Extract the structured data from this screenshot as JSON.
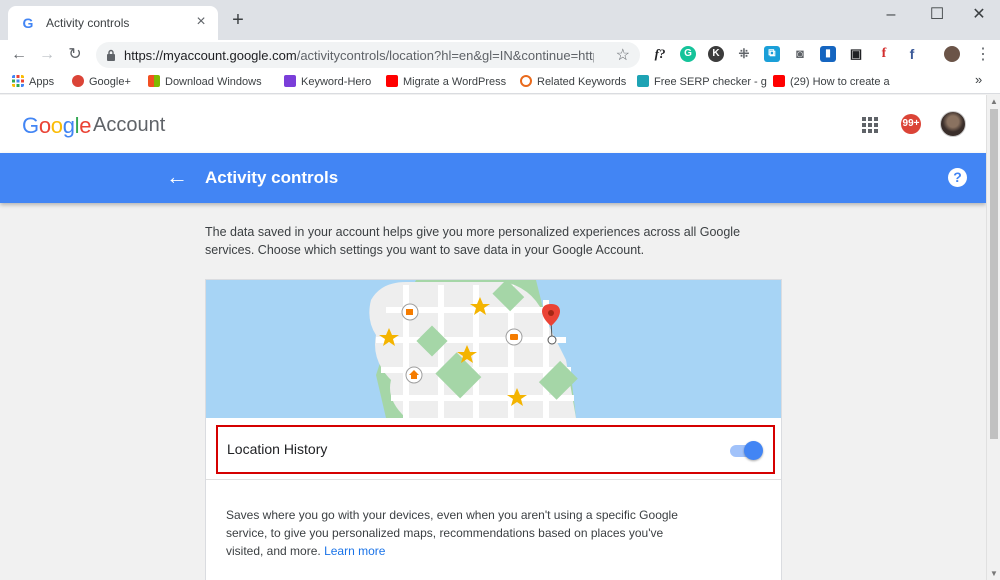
{
  "browser": {
    "tab_title": "Activity controls",
    "url_host": "https://myaccount.google.com",
    "url_path": "/activitycontrols/location?hl=en&gl=IN&continue=http...",
    "window_controls": [
      "–",
      "☐",
      "✕"
    ],
    "bookmarks": [
      {
        "label": "Apps",
        "color": "#e94235"
      },
      {
        "label": "Google+",
        "color": "#db4437"
      },
      {
        "label": "Download Windows",
        "color": "#f25022"
      },
      {
        "label": "Keyword-Hero",
        "color": "#7a3ed9"
      },
      {
        "label": "Migrate a WordPress",
        "color": "#ff0000"
      },
      {
        "label": "Related Keywords",
        "color": "#e96a1c"
      },
      {
        "label": "Free SERP checker - g",
        "color": "#1ea3b4"
      },
      {
        "label": "(29) How to create a",
        "color": "#ff0000"
      }
    ],
    "more_bookmarks": "»"
  },
  "account": {
    "logo_word": "Google",
    "logo_suffix": "Account",
    "notification_count": "99+"
  },
  "header": {
    "title": "Activity controls",
    "help_icon": "?"
  },
  "intro_text": "The data saved in your account helps give you more personalized experiences across all Google services. Choose which settings you want to save data in your Google Account.",
  "location_history": {
    "label": "Location History",
    "enabled": true,
    "description": "Saves where you go with your devices, even when you aren't using a specific Google service, to give you personalized maps, recommendations based on places you've visited, and more.",
    "learn_more": "Learn more"
  },
  "colors": {
    "accent": "#4285f4",
    "highlight_border": "#d50000",
    "link": "#1a73e8"
  }
}
